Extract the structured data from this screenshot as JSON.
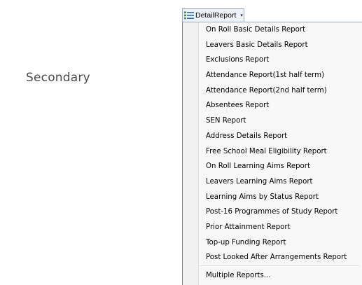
{
  "side_label": "Secondary",
  "toolbar": {
    "button_label": "DetailReport",
    "caret": "▾"
  },
  "menu": {
    "items": [
      "On Roll Basic Details Report",
      "Leavers Basic Details Report",
      "Exclusions Report",
      "Attendance Report(1st half term)",
      "Attendance Report(2nd half term)",
      "Absentees Report",
      "SEN Report",
      "Address Details Report",
      "Free School Meal Eligibility Report",
      "On Roll Learning Aims Report",
      "Leavers Learning Aims Report",
      "Learning Aims by Status Report",
      "Post-16 Programmes of Study Report",
      "Prior Attainment Report",
      "Top-up Funding Report",
      "Post Looked After Arrangements Report"
    ],
    "footer_item": "Multiple Reports..."
  },
  "colors": {
    "icon_green": "#2e9e3c",
    "icon_blue": "#2b6cc4"
  }
}
